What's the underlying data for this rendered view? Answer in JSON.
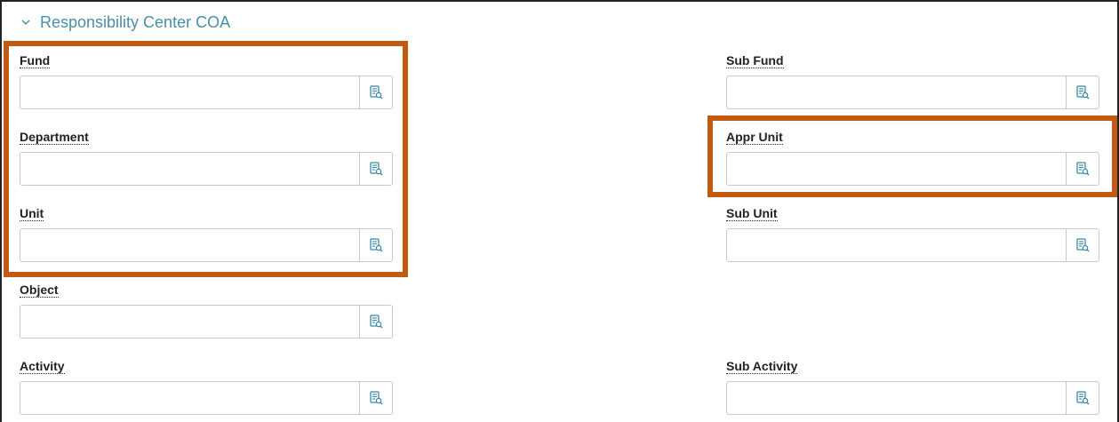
{
  "section": {
    "title": "Responsibility Center COA",
    "expanded": true
  },
  "fields": {
    "fund": {
      "label": "Fund",
      "value": ""
    },
    "sub_fund": {
      "label": "Sub Fund",
      "value": ""
    },
    "department": {
      "label": "Department",
      "value": ""
    },
    "appr_unit": {
      "label": "Appr Unit",
      "value": ""
    },
    "unit": {
      "label": "Unit",
      "value": ""
    },
    "sub_unit": {
      "label": "Sub Unit",
      "value": ""
    },
    "object": {
      "label": "Object",
      "value": ""
    },
    "activity": {
      "label": "Activity",
      "value": ""
    },
    "sub_activity": {
      "label": "Sub Activity",
      "value": ""
    }
  },
  "icons": {
    "section_toggle": "chevron-down-icon",
    "lookup": "lookup-document-search-icon"
  },
  "colors": {
    "highlight": "#c15a12",
    "section_title": "#4a8fa8",
    "icon": "#3a8aa6"
  }
}
